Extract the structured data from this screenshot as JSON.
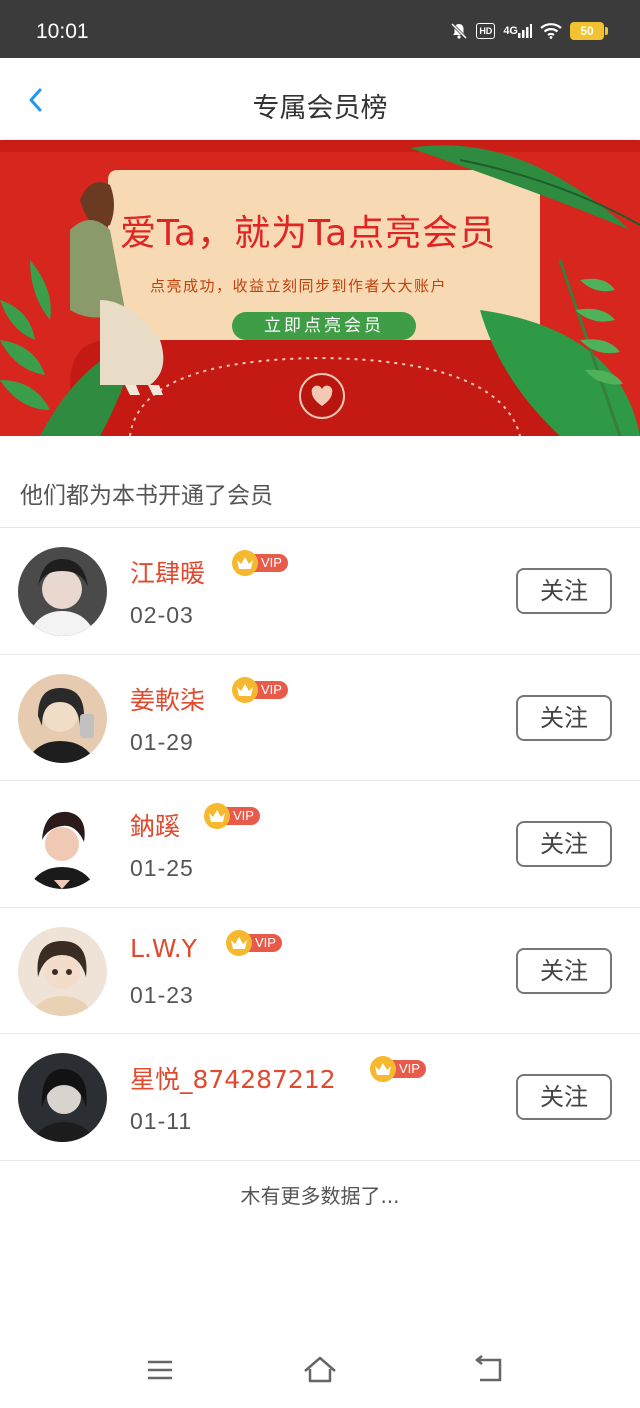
{
  "status_bar": {
    "time": "10:01",
    "hd_label": "HD",
    "network_label": "4G",
    "battery_level": "50"
  },
  "header": {
    "title": "专属会员榜"
  },
  "banner": {
    "headline": "爱Ta，就为Ta点亮会员",
    "subtitle": "点亮成功，收益立刻同步到作者大大账户",
    "cta_label": "立即点亮会员"
  },
  "section": {
    "title": "他们都为本书开通了会员"
  },
  "members": [
    {
      "name": "江肆暖",
      "date": "02-03",
      "vip_label": "VIP",
      "follow_label": "关注"
    },
    {
      "name": "姜軟柒",
      "date": "01-29",
      "vip_label": "VIP",
      "follow_label": "关注"
    },
    {
      "name": "鈉蹊",
      "date": "01-25",
      "vip_label": "VIP",
      "follow_label": "关注"
    },
    {
      "name": "L.W.Y",
      "date": "01-23",
      "vip_label": "VIP",
      "follow_label": "关注"
    },
    {
      "name": "星悦_874287212",
      "date": "01-11",
      "vip_label": "VIP",
      "follow_label": "关注"
    }
  ],
  "footer": {
    "no_more_text": "木有更多数据了..."
  },
  "colors": {
    "accent_blue": "#2196f3",
    "name_red": "#e04a2f",
    "banner_red": "#d7261e",
    "vip_gold": "#f5b82e",
    "vip_red": "#e85a4a"
  },
  "icons": {
    "back": "chevron-left-icon",
    "vip": "crown-icon",
    "nav_menu": "menu-icon",
    "nav_home": "home-icon",
    "nav_back": "back-icon"
  }
}
